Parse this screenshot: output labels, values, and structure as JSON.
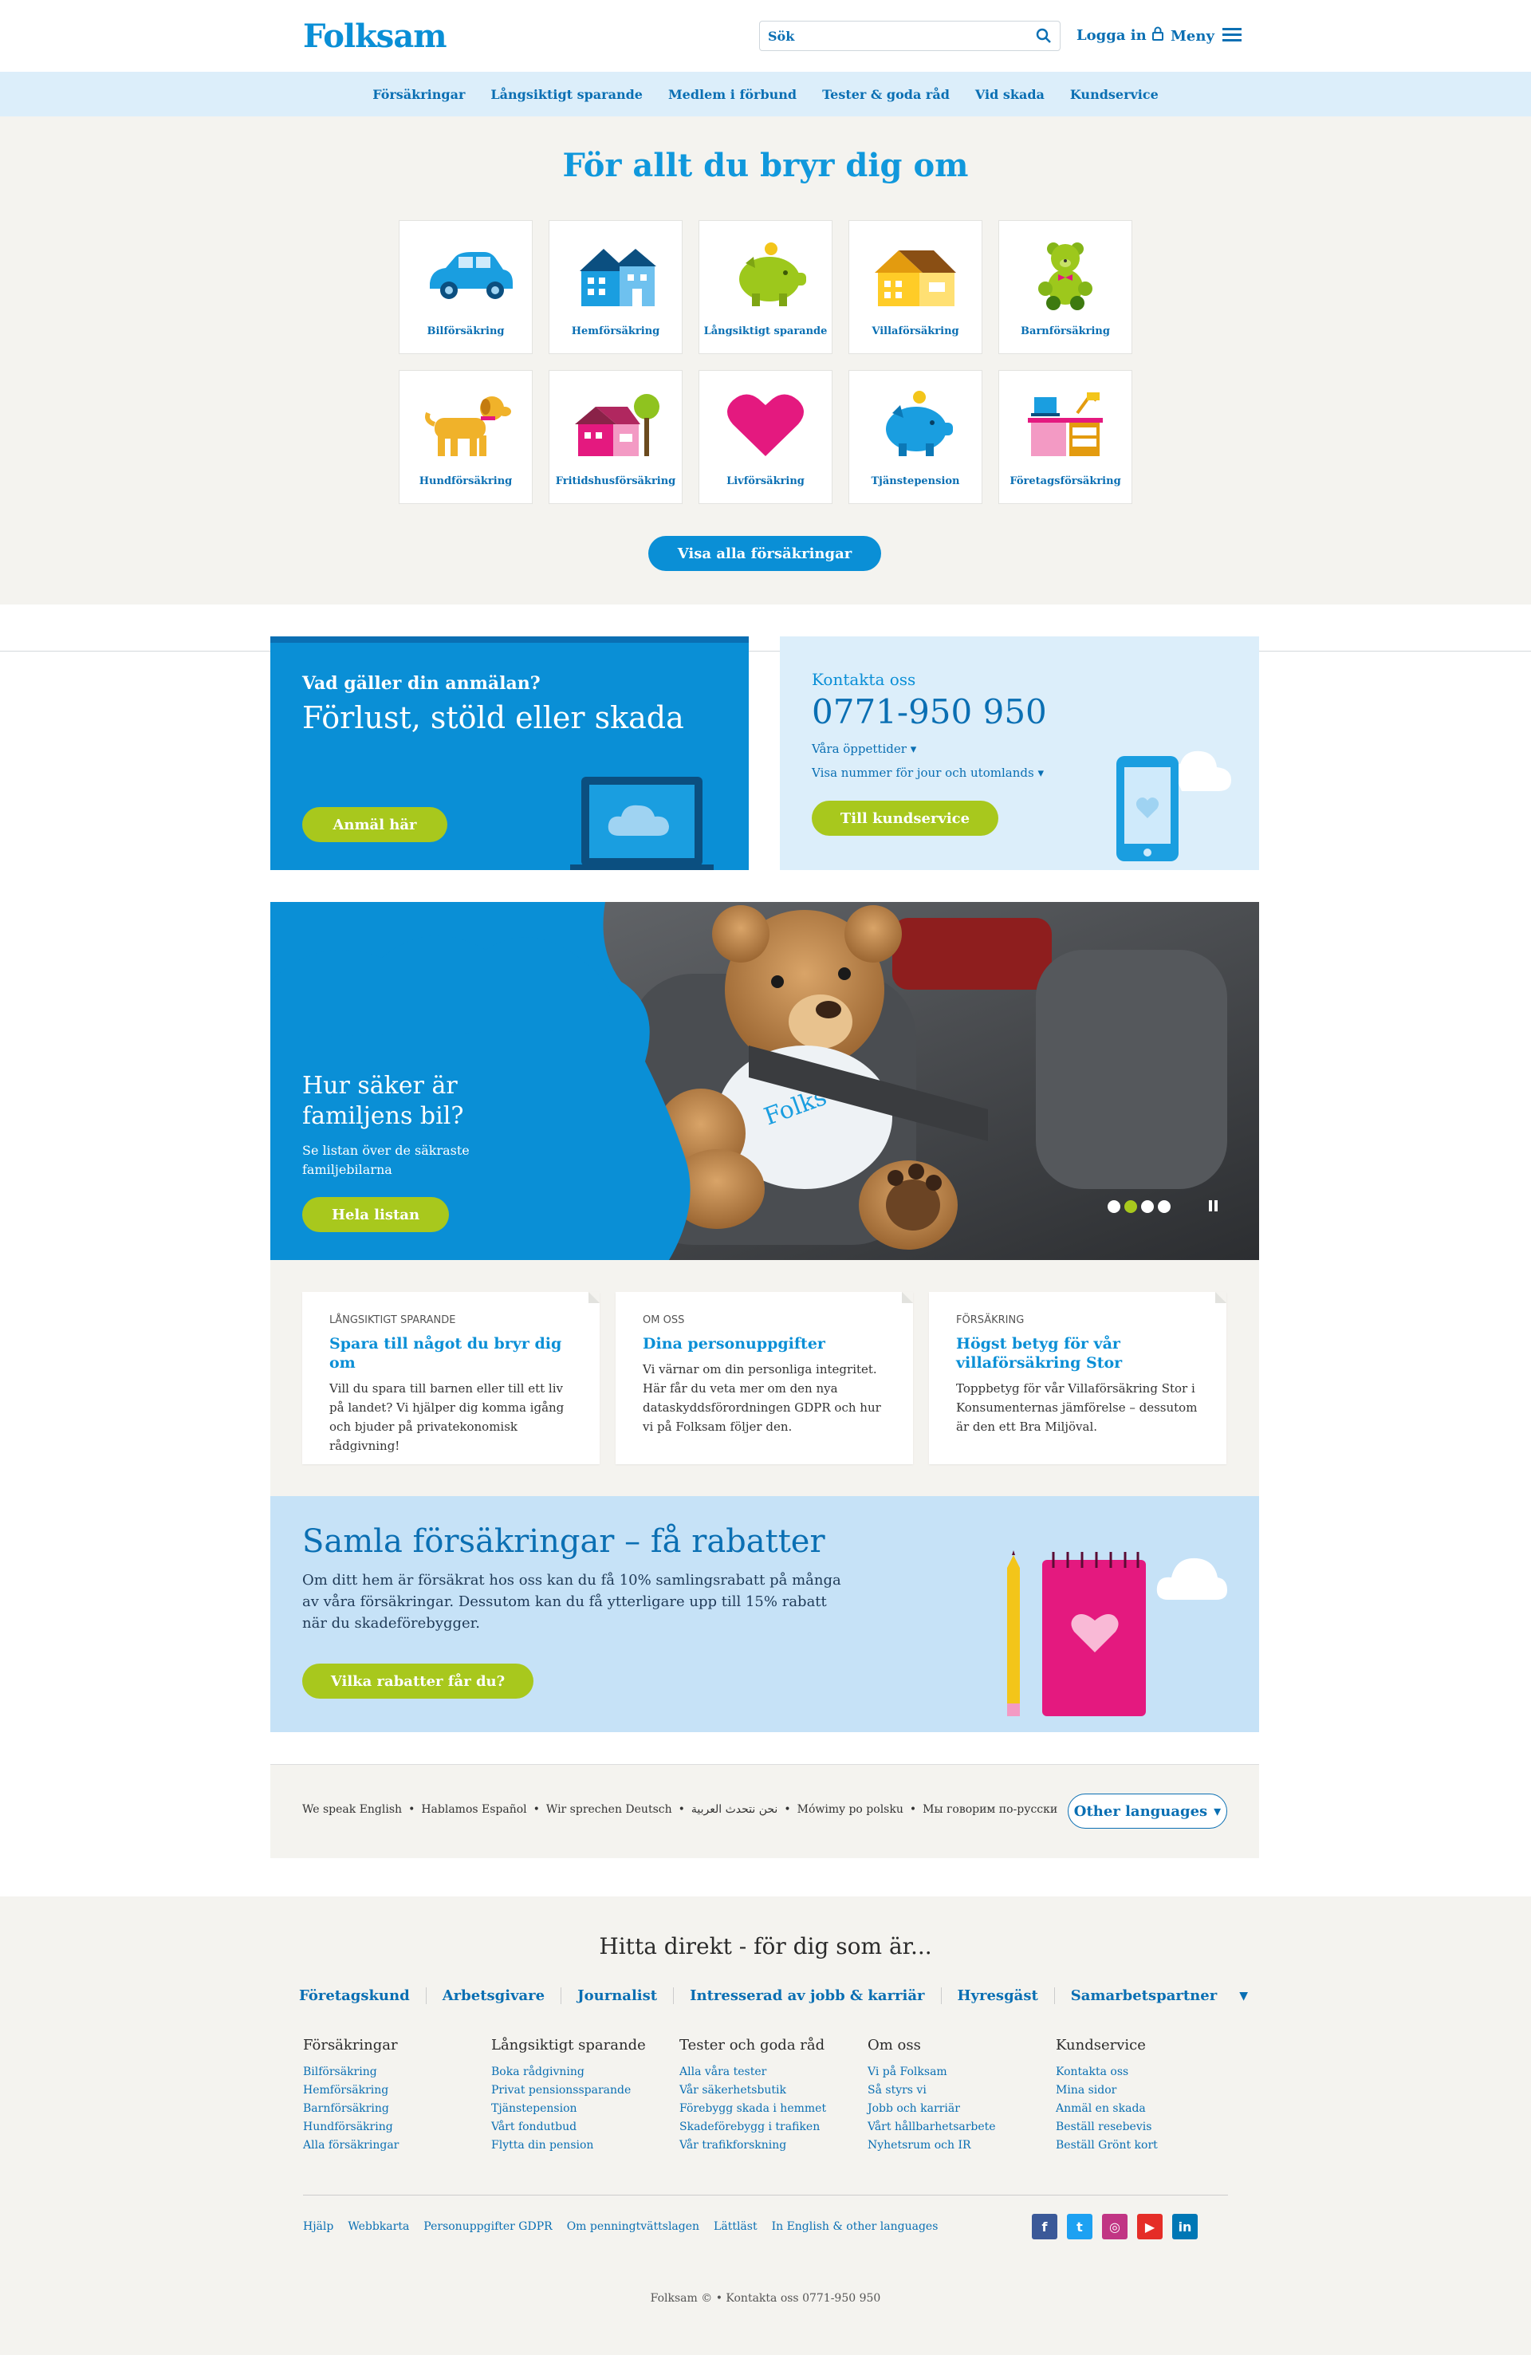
{
  "header": {
    "logo": "Folksam",
    "search_placeholder": "Sök",
    "login": "Logga in",
    "menu": "Meny"
  },
  "nav": [
    "Försäkringar",
    "Långsiktigt sparande",
    "Medlem i förbund",
    "Tester & goda råd",
    "Vid skada",
    "Kundservice"
  ],
  "hero": {
    "title": "För allt du bryr dig om",
    "tiles": [
      {
        "label": "Bilförsäkring",
        "icon": "car-icon"
      },
      {
        "label": "Hemförsäkring",
        "icon": "apartment-icon"
      },
      {
        "label": "Långsiktigt sparande",
        "icon": "piggy-bank-green-icon"
      },
      {
        "label": "Villaförsäkring",
        "icon": "house-icon"
      },
      {
        "label": "Barnförsäkring",
        "icon": "teddy-bear-icon"
      },
      {
        "label": "Hundförsäkring",
        "icon": "dog-icon"
      },
      {
        "label": "Fritidshusförsäkring",
        "icon": "cottage-icon"
      },
      {
        "label": "Livförsäkring",
        "icon": "heart-icon"
      },
      {
        "label": "Tjänstepension",
        "icon": "piggy-bank-blue-icon"
      },
      {
        "label": "Företagsförsäkring",
        "icon": "office-desk-icon"
      }
    ],
    "button": "Visa alla försäkringar"
  },
  "claim": {
    "question": "Vad gäller din anmälan?",
    "headline": "Förlust, stöld eller skada",
    "button": "Anmäl här"
  },
  "contact": {
    "title": "Kontakta oss",
    "phone": "0771-950 950",
    "link_hours": "Våra öppettider",
    "link_numbers": "Visa nummer för jour och utomlands",
    "button": "Till kundservice"
  },
  "banner": {
    "headline": "Hur säker är familjens bil?",
    "text": "Se listan över de säkraste familjebilarna",
    "button": "Hela listan",
    "slides": 4,
    "active_slide": 2
  },
  "cards": [
    {
      "category": "LÅNGSIKTIGT SPARANDE",
      "title": "Spara till något du bryr dig om",
      "body": "Vill du spara till barnen eller till ett liv på landet? Vi hjälper dig komma igång och bjuder på privatekonomisk rådgivning!"
    },
    {
      "category": "OM OSS",
      "title": "Dina personuppgifter",
      "body": "Vi värnar om din personliga integritet. Här får du veta mer om den nya dataskyddsförordningen GDPR och hur vi på Folksam följer den."
    },
    {
      "category": "FÖRSÄKRING",
      "title": "Högst betyg för vår villaförsäkring Stor",
      "body": "Toppbetyg för vår Villaförsäkring Stor i Konsumenternas jämförelse – dessutom är den ett Bra Miljöval."
    }
  ],
  "samla": {
    "headline": "Samla försäkringar – få rabatter",
    "text": "Om ditt hem är försäkrat hos oss kan du få 10% samlingsrabatt på många av våra försäkringar. Dessutom kan du få ytterligare upp till 15% rabatt när du skadeförebygger.",
    "button": "Vilka rabatter får du?"
  },
  "languages": {
    "items": [
      "We speak English",
      "Hablamos Español",
      "Wir sprechen Deutsch",
      "نحن نتحدث العربية",
      "Mówimy po polsku",
      "Мы говорим по-русски"
    ],
    "button": "Other languages"
  },
  "footer": {
    "heading": "Hitta direkt - för dig som är...",
    "roles": [
      "Företagskund",
      "Arbetsgivare",
      "Journalist",
      "Intresserad av jobb & karriär",
      "Hyresgäst",
      "Samarbetspartner"
    ],
    "columns": [
      {
        "title": "Försäkringar",
        "links": [
          "Bilförsäkring",
          "Hemförsäkring",
          "Barnförsäkring",
          "Hundförsäkring",
          "Alla försäkringar"
        ]
      },
      {
        "title": "Långsiktigt sparande",
        "links": [
          "Boka rådgivning",
          "Privat pensionssparande",
          "Tjänstepension",
          "Vårt fondutbud",
          "Flytta din pension"
        ]
      },
      {
        "title": "Tester och goda råd",
        "links": [
          "Alla våra tester",
          "Vår säkerhetsbutik",
          "Förebygg skada i hemmet",
          "Skadeförebygg i trafiken",
          "Vår trafikforskning"
        ]
      },
      {
        "title": "Om oss",
        "links": [
          "Vi på Folksam",
          "Så styrs vi",
          "Jobb och karriär",
          "Vårt hållbarhetsarbete",
          "Nyhetsrum och IR"
        ]
      },
      {
        "title": "Kundservice",
        "links": [
          "Kontakta oss",
          "Mina sidor",
          "Anmäl en skada",
          "Beställ resebevis",
          "Beställ Grönt kort"
        ]
      }
    ],
    "bottom_links": [
      "Hjälp",
      "Webbkarta",
      "Personuppgifter GDPR",
      "Om penningtvättslagen",
      "Lättläst",
      "In English & other languages"
    ],
    "social": [
      {
        "name": "facebook-icon",
        "glyph": "f",
        "color": "#3b5998"
      },
      {
        "name": "twitter-icon",
        "glyph": "t",
        "color": "#1da1f2"
      },
      {
        "name": "instagram-icon",
        "glyph": "◎",
        "color": "#c13584"
      },
      {
        "name": "youtube-icon",
        "glyph": "▶",
        "color": "#e52d27"
      },
      {
        "name": "linkedin-icon",
        "glyph": "in",
        "color": "#0077b5"
      }
    ],
    "copyright": "Folksam © •  Kontakta oss  0771-950 950"
  }
}
